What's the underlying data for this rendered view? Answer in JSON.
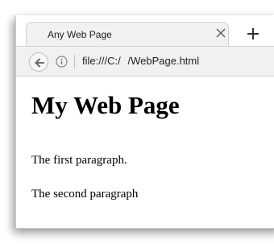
{
  "browser": {
    "tab": {
      "title": "Any Web Page",
      "close_icon": "close-icon"
    },
    "new_tab_icon": "plus-icon",
    "toolbar": {
      "back_icon": "arrow-left-icon",
      "info_icon": "info-icon",
      "url": "file:///C:/   /WebPage.html"
    }
  },
  "page": {
    "heading": "My Web Page",
    "paragraphs": [
      "The first paragraph.",
      "The second paragraph"
    ]
  },
  "colors": {
    "tab_background": "#f1f1f1",
    "toolbar_background": "#f1f1f1",
    "text": "#000000"
  }
}
